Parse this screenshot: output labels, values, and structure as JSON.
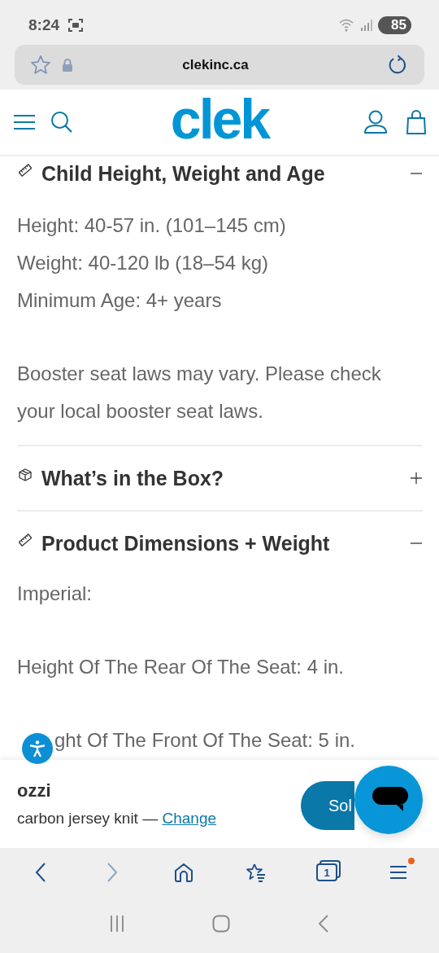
{
  "status_bar": {
    "time": "8:24",
    "battery": "85"
  },
  "address_bar": {
    "url": "clekinc.ca"
  },
  "header": {
    "logo": "clek"
  },
  "sections": [
    {
      "title": "Child Height, Weight and Age",
      "expanded": true,
      "paragraphs": [
        [
          "Height: 40-57 in. (101–145 cm)",
          "Weight: 40-120 lb (18–54 kg)",
          "Minimum Age: 4+ years"
        ],
        [
          "Booster seat laws may vary. Please check your local booster seat laws."
        ]
      ]
    },
    {
      "title": "What’s in the Box?",
      "expanded": false
    },
    {
      "title": "Product Dimensions + Weight",
      "expanded": true,
      "paragraphs": [
        [
          "Imperial:"
        ],
        [
          "Height Of The Rear Of The Seat: 4 in."
        ],
        [
          "ght Of The Front Of The Seat: 5 in."
        ]
      ]
    }
  ],
  "purchase_bar": {
    "product": "ozzi",
    "variant": "carbon jersey knit — ",
    "change_link": "Change",
    "button": "Sol"
  },
  "browser_toolbar": [
    {
      "kind": "back",
      "disabled": false
    },
    {
      "kind": "forward",
      "disabled": true
    },
    {
      "kind": "home",
      "disabled": false
    },
    {
      "kind": "bookmarks",
      "disabled": false
    },
    {
      "kind": "tabs",
      "disabled": false,
      "count": "1"
    },
    {
      "kind": "menu",
      "disabled": false,
      "notification": true
    }
  ]
}
